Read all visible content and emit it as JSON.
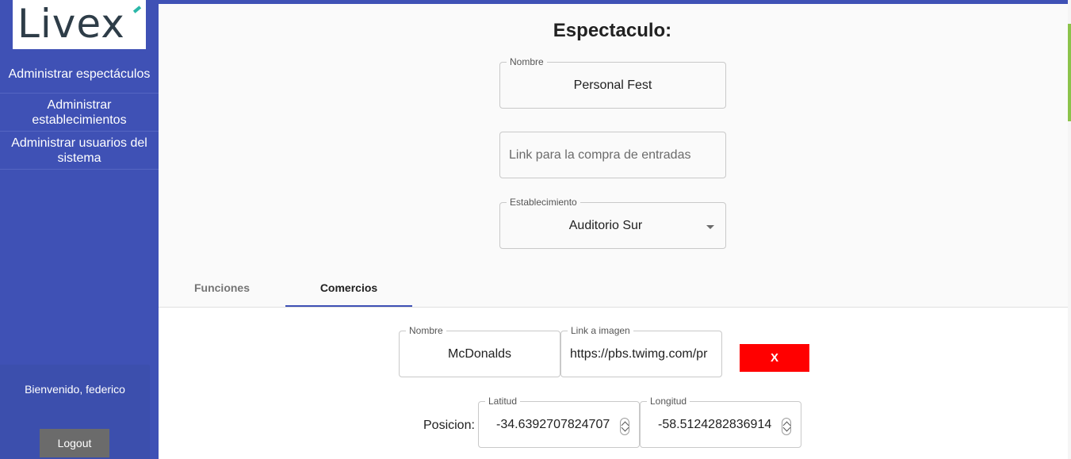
{
  "sidebar": {
    "logo_text": "Livex",
    "items": [
      {
        "label": "Administrar espectáculos"
      },
      {
        "label": "Administrar establecimientos"
      },
      {
        "label": "Administrar usuarios del sistema"
      }
    ],
    "welcome": "Bienvenido, federico",
    "logout_label": "Logout"
  },
  "form": {
    "title": "Espectaculo:",
    "nombre": {
      "label": "Nombre",
      "value": "Personal Fest"
    },
    "link": {
      "placeholder": "Link para la compra de entradas",
      "value": ""
    },
    "establecimiento": {
      "label": "Establecimiento",
      "value": "Auditorio Sur"
    }
  },
  "tabs": [
    {
      "label": "Funciones",
      "active": false
    },
    {
      "label": "Comercios",
      "active": true
    }
  ],
  "comercio": {
    "nombre": {
      "label": "Nombre",
      "value": "McDonalds"
    },
    "imagen": {
      "label": "Link a imagen",
      "value": "https://pbs.twimg.com/pr"
    },
    "delete_label": "X",
    "posicion_label": "Posicion:",
    "latitud": {
      "label": "Latitud",
      "value": "-34.6392707824707"
    },
    "longitud": {
      "label": "Longitud",
      "value": "-58.5124282836914"
    }
  },
  "colors": {
    "primary": "#3f51b5",
    "delete": "#ff0000",
    "scrollbar": "#8bc34a"
  }
}
